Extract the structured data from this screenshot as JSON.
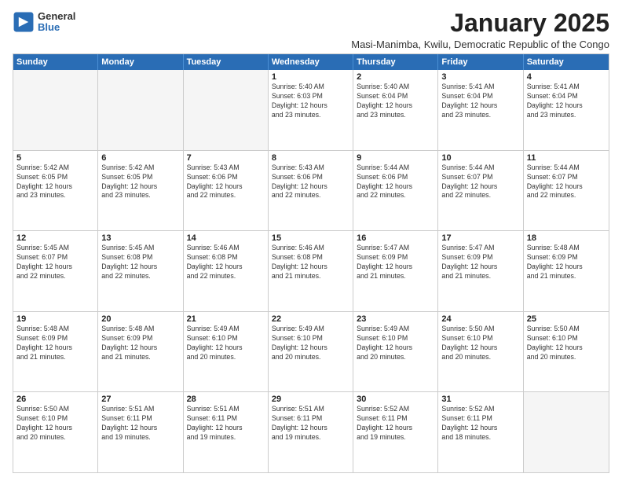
{
  "logo": {
    "general": "General",
    "blue": "Blue",
    "icon": "▶"
  },
  "title": "January 2025",
  "subtitle": "Masi-Manimba, Kwilu, Democratic Republic of the Congo",
  "headers": [
    "Sunday",
    "Monday",
    "Tuesday",
    "Wednesday",
    "Thursday",
    "Friday",
    "Saturday"
  ],
  "rows": [
    [
      {
        "day": "",
        "info": "",
        "empty": true
      },
      {
        "day": "",
        "info": "",
        "empty": true
      },
      {
        "day": "",
        "info": "",
        "empty": true
      },
      {
        "day": "1",
        "info": "Sunrise: 5:40 AM\nSunset: 6:03 PM\nDaylight: 12 hours\nand 23 minutes."
      },
      {
        "day": "2",
        "info": "Sunrise: 5:40 AM\nSunset: 6:04 PM\nDaylight: 12 hours\nand 23 minutes."
      },
      {
        "day": "3",
        "info": "Sunrise: 5:41 AM\nSunset: 6:04 PM\nDaylight: 12 hours\nand 23 minutes."
      },
      {
        "day": "4",
        "info": "Sunrise: 5:41 AM\nSunset: 6:04 PM\nDaylight: 12 hours\nand 23 minutes."
      }
    ],
    [
      {
        "day": "5",
        "info": "Sunrise: 5:42 AM\nSunset: 6:05 PM\nDaylight: 12 hours\nand 23 minutes."
      },
      {
        "day": "6",
        "info": "Sunrise: 5:42 AM\nSunset: 6:05 PM\nDaylight: 12 hours\nand 23 minutes."
      },
      {
        "day": "7",
        "info": "Sunrise: 5:43 AM\nSunset: 6:06 PM\nDaylight: 12 hours\nand 22 minutes."
      },
      {
        "day": "8",
        "info": "Sunrise: 5:43 AM\nSunset: 6:06 PM\nDaylight: 12 hours\nand 22 minutes."
      },
      {
        "day": "9",
        "info": "Sunrise: 5:44 AM\nSunset: 6:06 PM\nDaylight: 12 hours\nand 22 minutes."
      },
      {
        "day": "10",
        "info": "Sunrise: 5:44 AM\nSunset: 6:07 PM\nDaylight: 12 hours\nand 22 minutes."
      },
      {
        "day": "11",
        "info": "Sunrise: 5:44 AM\nSunset: 6:07 PM\nDaylight: 12 hours\nand 22 minutes."
      }
    ],
    [
      {
        "day": "12",
        "info": "Sunrise: 5:45 AM\nSunset: 6:07 PM\nDaylight: 12 hours\nand 22 minutes."
      },
      {
        "day": "13",
        "info": "Sunrise: 5:45 AM\nSunset: 6:08 PM\nDaylight: 12 hours\nand 22 minutes."
      },
      {
        "day": "14",
        "info": "Sunrise: 5:46 AM\nSunset: 6:08 PM\nDaylight: 12 hours\nand 22 minutes."
      },
      {
        "day": "15",
        "info": "Sunrise: 5:46 AM\nSunset: 6:08 PM\nDaylight: 12 hours\nand 21 minutes."
      },
      {
        "day": "16",
        "info": "Sunrise: 5:47 AM\nSunset: 6:09 PM\nDaylight: 12 hours\nand 21 minutes."
      },
      {
        "day": "17",
        "info": "Sunrise: 5:47 AM\nSunset: 6:09 PM\nDaylight: 12 hours\nand 21 minutes."
      },
      {
        "day": "18",
        "info": "Sunrise: 5:48 AM\nSunset: 6:09 PM\nDaylight: 12 hours\nand 21 minutes."
      }
    ],
    [
      {
        "day": "19",
        "info": "Sunrise: 5:48 AM\nSunset: 6:09 PM\nDaylight: 12 hours\nand 21 minutes."
      },
      {
        "day": "20",
        "info": "Sunrise: 5:48 AM\nSunset: 6:09 PM\nDaylight: 12 hours\nand 21 minutes."
      },
      {
        "day": "21",
        "info": "Sunrise: 5:49 AM\nSunset: 6:10 PM\nDaylight: 12 hours\nand 20 minutes."
      },
      {
        "day": "22",
        "info": "Sunrise: 5:49 AM\nSunset: 6:10 PM\nDaylight: 12 hours\nand 20 minutes."
      },
      {
        "day": "23",
        "info": "Sunrise: 5:49 AM\nSunset: 6:10 PM\nDaylight: 12 hours\nand 20 minutes."
      },
      {
        "day": "24",
        "info": "Sunrise: 5:50 AM\nSunset: 6:10 PM\nDaylight: 12 hours\nand 20 minutes."
      },
      {
        "day": "25",
        "info": "Sunrise: 5:50 AM\nSunset: 6:10 PM\nDaylight: 12 hours\nand 20 minutes."
      }
    ],
    [
      {
        "day": "26",
        "info": "Sunrise: 5:50 AM\nSunset: 6:10 PM\nDaylight: 12 hours\nand 20 minutes."
      },
      {
        "day": "27",
        "info": "Sunrise: 5:51 AM\nSunset: 6:11 PM\nDaylight: 12 hours\nand 19 minutes."
      },
      {
        "day": "28",
        "info": "Sunrise: 5:51 AM\nSunset: 6:11 PM\nDaylight: 12 hours\nand 19 minutes."
      },
      {
        "day": "29",
        "info": "Sunrise: 5:51 AM\nSunset: 6:11 PM\nDaylight: 12 hours\nand 19 minutes."
      },
      {
        "day": "30",
        "info": "Sunrise: 5:52 AM\nSunset: 6:11 PM\nDaylight: 12 hours\nand 19 minutes."
      },
      {
        "day": "31",
        "info": "Sunrise: 5:52 AM\nSunset: 6:11 PM\nDaylight: 12 hours\nand 18 minutes."
      },
      {
        "day": "",
        "info": "",
        "empty": true
      }
    ]
  ]
}
